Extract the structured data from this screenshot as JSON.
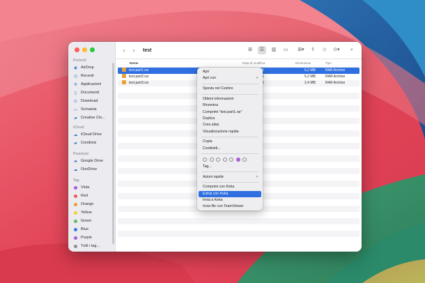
{
  "colors": {
    "accent": "#2f6fe0",
    "tag_red": "#ec5b5b",
    "tag_orange": "#f29b38",
    "tag_yellow": "#f4cf3a",
    "tag_green": "#5dc05d",
    "tag_blue": "#3b7be0",
    "tag_purple": "#a560d8",
    "tag_gray": "#8e8e93"
  },
  "window": {
    "title": "test",
    "icons": [
      "chevron-left-icon",
      "chevron-right-icon",
      "icon-view-icon",
      "list-view-icon",
      "column-view-icon",
      "gallery-view-icon",
      "group-icon",
      "share-icon",
      "tag-icon",
      "more-icon",
      "search-icon"
    ]
  },
  "sidebar": {
    "favorites_header": "Preferiti",
    "favorites": [
      {
        "label": "AirDrop",
        "icon": "airdrop-icon"
      },
      {
        "label": "Recenti",
        "icon": "clock-icon"
      },
      {
        "label": "Applicazioni",
        "icon": "apps-icon"
      },
      {
        "label": "Documenti",
        "icon": "document-icon"
      },
      {
        "label": "Download",
        "icon": "download-icon"
      },
      {
        "label": "Scrivania",
        "icon": "desktop-icon"
      },
      {
        "label": "Creative Clo...",
        "icon": "folder-icon"
      }
    ],
    "icloud_header": "iCloud",
    "icloud": [
      {
        "label": "iCloud Drive",
        "icon": "cloud-icon"
      },
      {
        "label": "Condivisi",
        "icon": "shared-folder-icon"
      }
    ],
    "locations_header": "Posizioni",
    "locations": [
      {
        "label": "Google Drive",
        "icon": "drive-icon"
      },
      {
        "label": "OneDrive",
        "icon": "cloud-icon"
      }
    ],
    "tags_header": "Tag",
    "tags": [
      {
        "label": "Viola",
        "color": "#a560d8"
      },
      {
        "label": "Red",
        "color": "#ec5b5b"
      },
      {
        "label": "Orange",
        "color": "#f29b38"
      },
      {
        "label": "Yellow",
        "color": "#f4cf3a"
      },
      {
        "label": "Green",
        "color": "#5dc05d"
      },
      {
        "label": "Blue",
        "color": "#3b7be0"
      },
      {
        "label": "Purple",
        "color": "#a560d8"
      },
      {
        "label": "Tutti i tag...",
        "color": "#8e8e93"
      }
    ]
  },
  "columns": {
    "name": "Nome",
    "modified": "Data di modifica",
    "size": "Dimensioni",
    "kind": "Tipo"
  },
  "files": [
    {
      "name": "test.part1.rar",
      "date": "5",
      "size": "5,2 MB",
      "kind": "RAR Archive"
    },
    {
      "name": "test.part2.rar",
      "date": "5",
      "size": "5,2 MB",
      "kind": "RAR Archive"
    },
    {
      "name": "test.part3.rar",
      "date": "5",
      "size": "2,4 MB",
      "kind": "RAR Archive"
    }
  ],
  "context_menu": {
    "open": "Apri",
    "open_with": "Apri con",
    "move_to_trash": "Sposta nel Cestino",
    "get_info": "Ottieni informazioni",
    "rename": "Rinomina",
    "compress": "Comprimi \"test.part1.rar\"",
    "duplicate": "Duplica",
    "make_alias": "Crea alias",
    "quick_look": "Visualizzazione rapida",
    "copy": "Copia",
    "share": "Condividi...",
    "tags": "Tag...",
    "quick_actions": "Azioni rapide",
    "compress_keka": "Comprimi con Keka",
    "extract_keka": "Estrai con Keka",
    "send_keka": "Invia a Keka",
    "send_teamviewer": "Invia file con TeamViewer",
    "tag_colors": [
      "#ec5b5b",
      "#f29b38",
      "#f4cf3a",
      "#5dc05d",
      "#3b7be0",
      "#a560d8",
      "#8e8e93"
    ]
  }
}
